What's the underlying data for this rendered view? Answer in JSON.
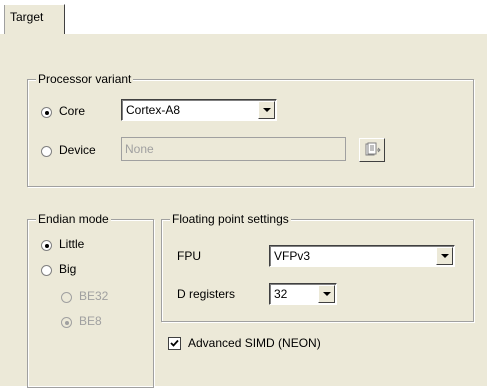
{
  "tabs": [
    {
      "label": "Target"
    }
  ],
  "processor_variant": {
    "title": "Processor variant",
    "core_label": "Core",
    "core_selected": true,
    "core_value": "Cortex-A8",
    "device_label": "Device",
    "device_selected": false,
    "device_value": "None"
  },
  "endian_mode": {
    "title": "Endian mode",
    "little_label": "Little",
    "little_selected": true,
    "big_label": "Big",
    "big_selected": false,
    "be32_label": "BE32",
    "be8_label": "BE8",
    "be8_selected": true
  },
  "floating_point": {
    "title": "Floating point settings",
    "fpu_label": "FPU",
    "fpu_value": "VFPv3",
    "dreg_label": "D registers",
    "dreg_value": "32"
  },
  "advanced_simd": {
    "label": "Advanced SIMD (NEON)",
    "checked": true
  },
  "icons": {
    "device_browse": "device-browse-icon"
  }
}
